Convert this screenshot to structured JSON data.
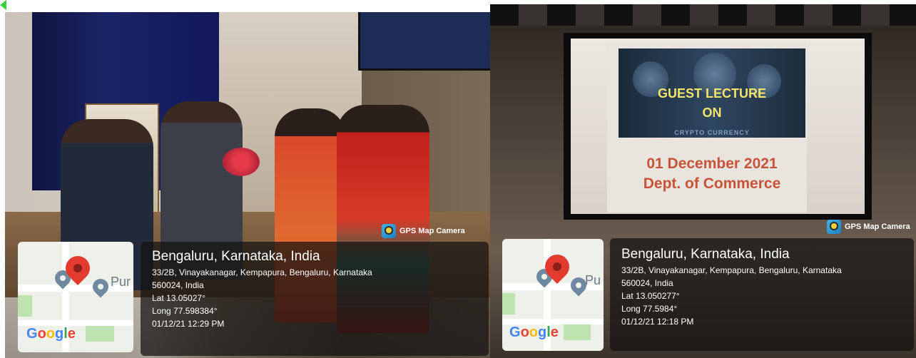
{
  "left_photo": {
    "gps_badge": "GPS Map Camera",
    "map_label": "Pur",
    "google_letters": [
      "G",
      "o",
      "o",
      "g",
      "l",
      "e"
    ],
    "location": "Bengaluru, Karnataka, India",
    "address_line1": "33/2B, Vinayakanagar, Kempapura, Bengaluru, Karnataka",
    "address_line2": "560024, India",
    "lat": "Lat 13.05027°",
    "long": "Long 77.598384°",
    "datetime": "01/12/21 12:29 PM"
  },
  "right_photo": {
    "gps_badge": "GPS Map Camera",
    "map_label": "Pu",
    "google_letters": [
      "G",
      "o",
      "o",
      "g",
      "l",
      "e"
    ],
    "location": "Bengaluru, Karnataka, India",
    "address_line1": "33/2B, Vinayakanagar, Kempapura, Bengaluru, Karnataka",
    "address_line2": "560024, India",
    "lat": "Lat 13.050277°",
    "long": "Long 77.5984°",
    "datetime": "01/12/21 12:18 PM",
    "slide": {
      "title_line1": "GUEST LECTURE",
      "title_line2": "ON",
      "subtitle": "CRYPTO CURRENCY",
      "date": "01 December 2021",
      "dept": "Dept. of Commerce"
    }
  },
  "colors": {
    "pin_red": "#e33b2e",
    "overlay": "#141210",
    "corner_arrow": "#3ecf3e"
  }
}
